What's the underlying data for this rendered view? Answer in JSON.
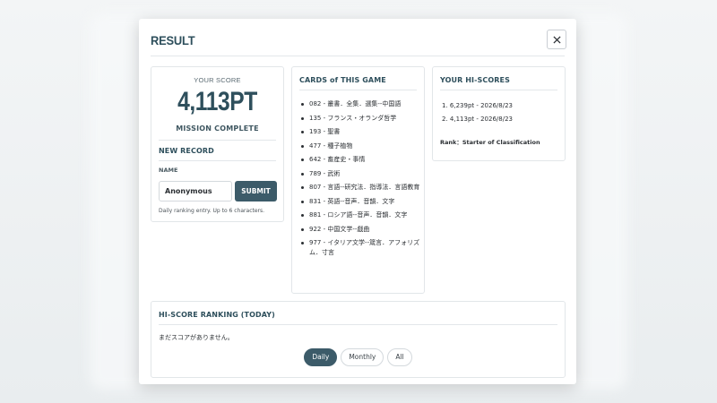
{
  "modal": {
    "title": "RESULT",
    "close_icon": "close-icon"
  },
  "score": {
    "label": "YOUR SCORE",
    "value": "4,113PT",
    "status": "MISSION COMPLETE"
  },
  "new_record": {
    "title": "NEW RECORD",
    "name_label": "NAME",
    "name_value": "Anonymous",
    "submit_label": "SUBMIT",
    "hint": "Daily ranking entry. Up to 6 characters."
  },
  "cards": {
    "title": "CARDS of THIS GAME",
    "items": [
      "082 - 叢書．全集．選集--中国語",
      "135 - フランス・オランダ哲学",
      "193 - 聖書",
      "477 - 種子植物",
      "642 - 畜産史・事情",
      "789 - 武術",
      "807 - 言語--研究法．指導法．言語教育",
      "831 - 英語--音声．音韻．文字",
      "881 - ロシア語--音声．音韻．文字",
      "922 - 中国文学--戯曲",
      "977 - イタリア文学--箴言．アフォリズム．寸言"
    ]
  },
  "hiscores": {
    "title": "YOUR HI-SCORES",
    "items": [
      "1. 6,239pt - 2026/8/23",
      "2. 4,113pt - 2026/8/23"
    ],
    "rank": "Rank：Starter of Classification"
  },
  "ranking": {
    "title": "HI-SCORE RANKING (TODAY)",
    "empty_text": "まだスコアがありません。",
    "tabs": [
      "Daily",
      "Monthly",
      "All"
    ],
    "active_tab": "Daily"
  },
  "colors": {
    "accent": "#3c5b69",
    "title": "#2e4f5c"
  }
}
